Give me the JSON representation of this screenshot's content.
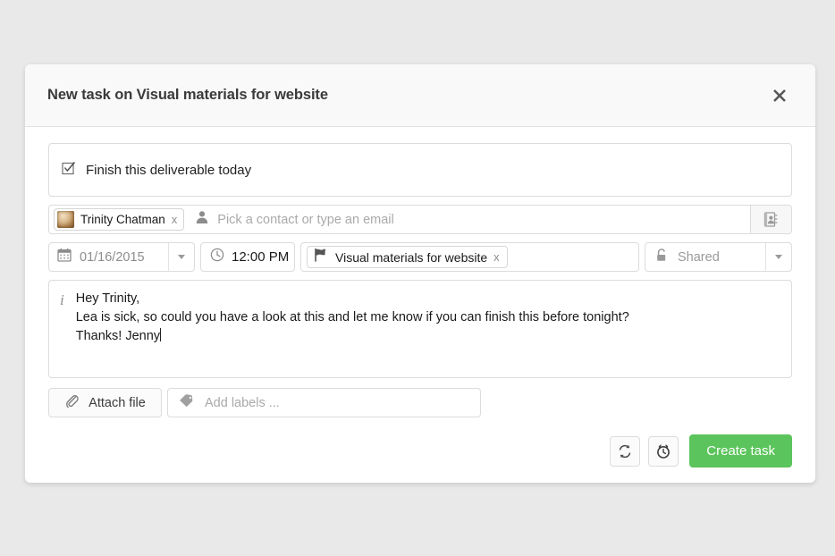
{
  "dialog": {
    "title": "New task on Visual materials for website",
    "close_icon": "close-icon"
  },
  "task": {
    "title_value": "Finish this deliverable today",
    "checkbox_icon": "checkbox-checked-icon"
  },
  "contacts": {
    "chip": {
      "name": "Trinity Chatman",
      "remove_label": "x",
      "avatar_icon": "avatar"
    },
    "placeholder": "Pick a contact or type an email",
    "person_icon": "person-icon",
    "addressbook_icon": "address-book-icon"
  },
  "meta": {
    "date_value": "01/16/2015",
    "date_icon": "calendar-icon",
    "time_value": "12:00 PM",
    "time_icon": "clock-icon",
    "project": {
      "name": "Visual materials for website",
      "remove_label": "x",
      "flag_icon": "flag-icon"
    },
    "sharing_value": "Shared",
    "sharing_icon": "unlocked-padlock-icon"
  },
  "message": {
    "info_icon": "i",
    "body": "Hey Trinity,\nLea is sick, so could you have a look at this and let me know if you can finish this before tonight?\nThanks! Jenny"
  },
  "attachments": {
    "attach_label": "Attach file",
    "attach_icon": "paperclip-icon",
    "labels_placeholder": "Add labels ...",
    "labels_icon": "tag-icon"
  },
  "footer": {
    "repeat_icon": "repeat-icon",
    "reminder_icon": "alarm-clock-icon",
    "create_label": "Create task"
  },
  "colors": {
    "accent_green": "#5cc45c",
    "page_background": "#e9e9e9",
    "header_background": "#f9f9f9"
  }
}
